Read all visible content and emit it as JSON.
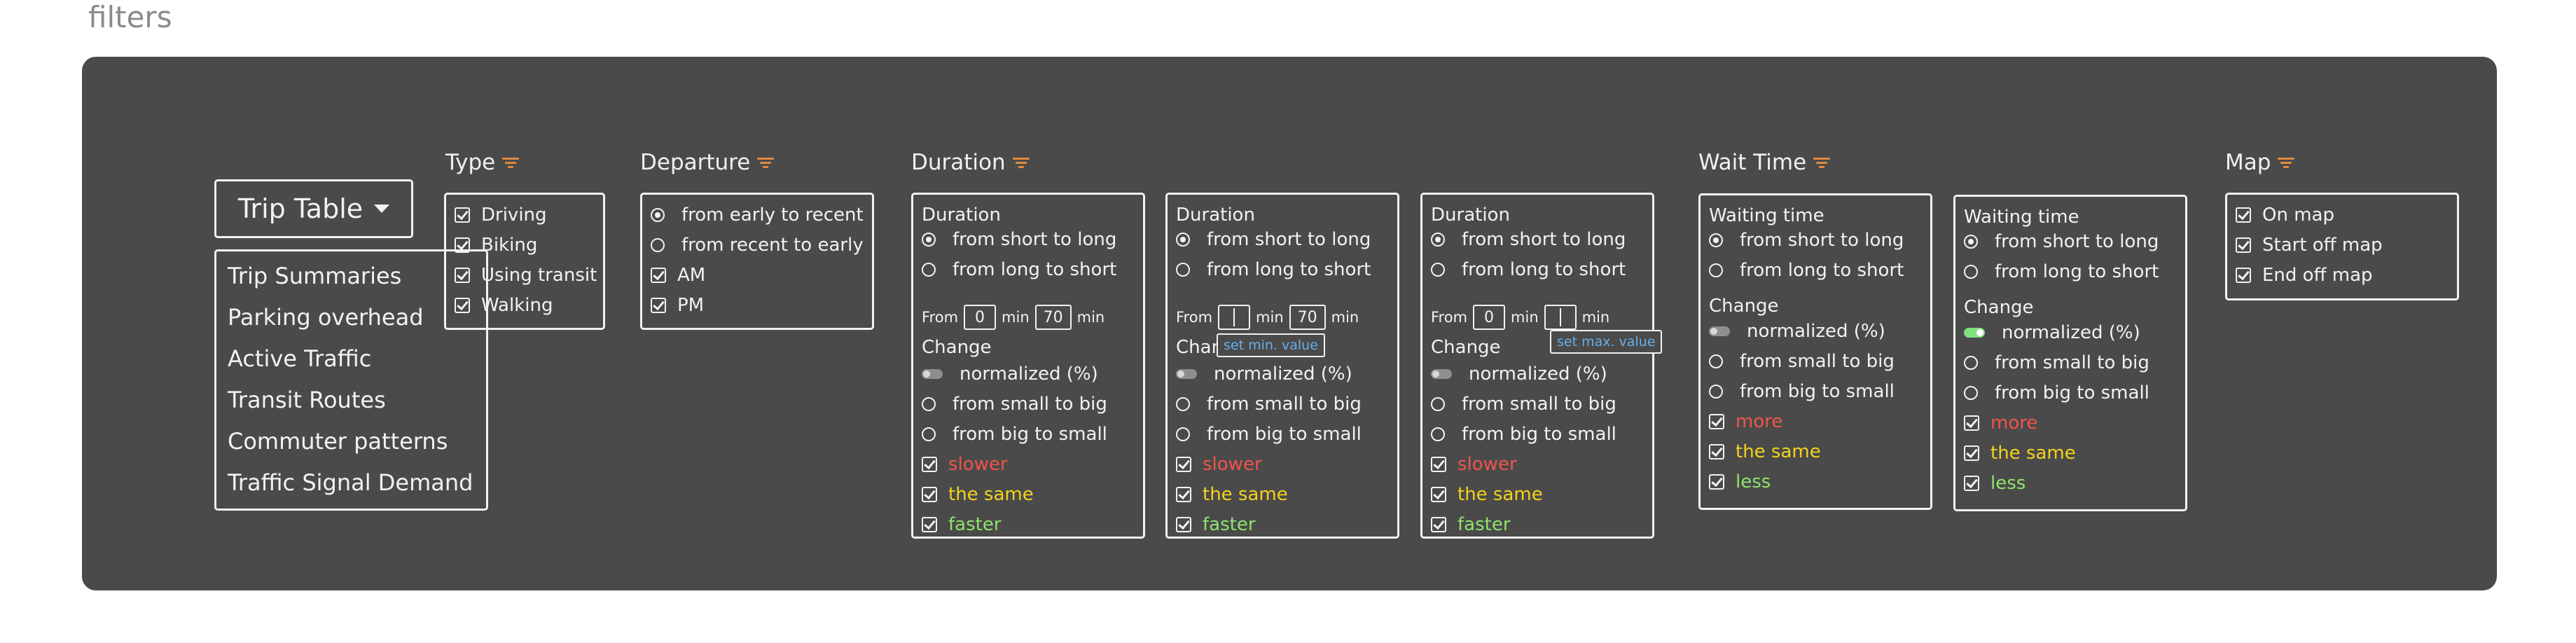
{
  "page": {
    "title": "filters"
  },
  "colors": {
    "panel": "#4a4a4a",
    "filter_icon": "#e08a3c",
    "red": "#f0544a",
    "yellow": "#f2d21b",
    "green": "#8fe36b",
    "tooltip_text": "#6aaee8"
  },
  "trip_table": {
    "button_label": "Trip Table",
    "items": [
      "Trip Summaries",
      "Parking overhead",
      "Active Traffic",
      "Transit Routes",
      "Commuter patterns",
      "Traffic Signal Demand"
    ]
  },
  "type_filter": {
    "title": "Type",
    "options": [
      {
        "label": "Driving",
        "checked": true
      },
      {
        "label": "Biking",
        "checked": true
      },
      {
        "label": "Using transit",
        "checked": true
      },
      {
        "label": "Walking",
        "checked": true
      }
    ]
  },
  "departure_filter": {
    "title": "Departure",
    "sort_options": [
      "from early to recent",
      "from recent to early"
    ],
    "checkboxes": [
      "AM",
      "PM"
    ]
  },
  "duration": {
    "title": "Duration",
    "cards": [
      {
        "label": "Duration",
        "sort_short": "from short to long",
        "sort_long": "from long to short",
        "from_label": "From",
        "min_value": "0",
        "min_unit": "min",
        "max_value": "70",
        "max_unit": "min",
        "change_label": "Change",
        "normalized": "normalized (%)",
        "small_big": "from small to big",
        "big_small": "from big to small",
        "c1": "slower",
        "c2": "the same",
        "c3": "faster"
      },
      {
        "label": "Duration",
        "sort_short": "from short to long",
        "sort_long": "from long to short",
        "from_label": "From",
        "min_value": "",
        "min_unit": "min",
        "max_value": "70",
        "max_unit": "min",
        "change_label": "Chan",
        "tooltip": "set min. value",
        "normalized": "normalized (%)",
        "small_big": "from small to big",
        "big_small": "from big to small",
        "c1": "slower",
        "c2": "the same",
        "c3": "faster"
      },
      {
        "label": "Duration",
        "sort_short": "from short to long",
        "sort_long": "from long to short",
        "from_label": "From",
        "min_value": "0",
        "min_unit": "min",
        "max_value": "",
        "max_unit": "min",
        "change_label": "Change",
        "tooltip": "set max. value",
        "normalized": "normalized (%)",
        "small_big": "from small to big",
        "big_small": "from big to small",
        "c1": "slower",
        "c2": "the same",
        "c3": "faster"
      }
    ]
  },
  "wait_time": {
    "title": "Wait Time",
    "cards": [
      {
        "label": "Waiting time",
        "sort_short": "from short to long",
        "sort_long": "from long to short",
        "change_label": "Change",
        "normalized": "normalized (%)",
        "normalized_on": false,
        "small_big": "from small to big",
        "big_small": "from big to small",
        "c1": "more",
        "c2": "the same",
        "c3": "less"
      },
      {
        "label": "Waiting time",
        "sort_short": "from short to long",
        "sort_long": "from long to short",
        "change_label": "Change",
        "normalized": "normalized (%)",
        "normalized_on": true,
        "small_big": "from small to big",
        "big_small": "from big to small",
        "c1": "more",
        "c2": "the same",
        "c3": "less"
      }
    ]
  },
  "map_filter": {
    "title": "Map",
    "options": [
      "On map",
      "Start off map",
      "End off map"
    ]
  }
}
